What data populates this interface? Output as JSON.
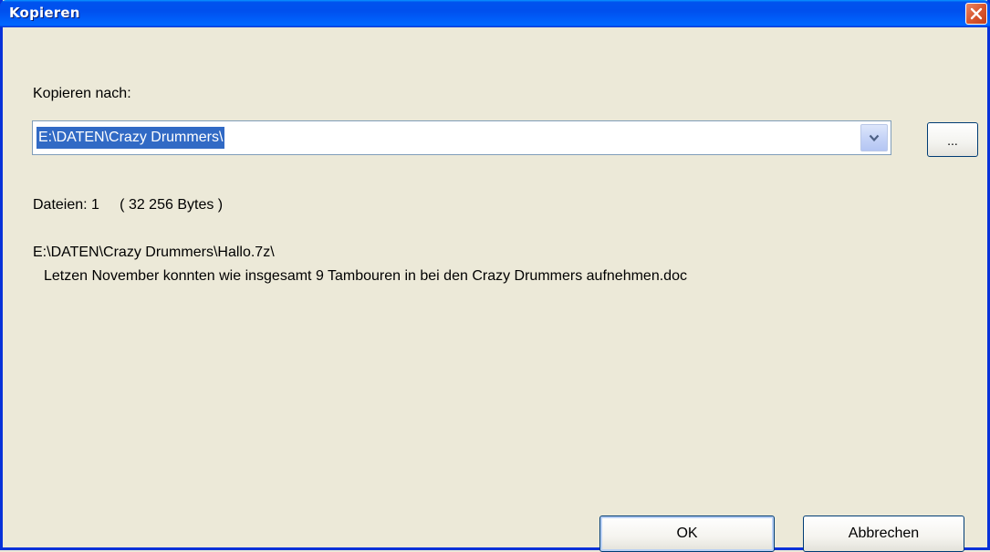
{
  "window": {
    "title": "Kopieren",
    "close_icon": "close-x-icon"
  },
  "form": {
    "copy_to_label": "Kopieren nach:",
    "destination_value": "E:\\DATEN\\Crazy Drummers\\",
    "dropdown_icon": "chevron-down-icon",
    "browse_label": "..."
  },
  "summary": {
    "files_text": "Dateien: 1     ( 32 256 Bytes )"
  },
  "source": {
    "path": "E:\\DATEN\\Crazy Drummers\\Hallo.7z\\",
    "file": "Letzen November konnten wie insgesamt 9 Tambouren in bei den Crazy Drummers aufnehmen.doc"
  },
  "buttons": {
    "ok_label": "OK",
    "cancel_label": "Abbrechen"
  },
  "colors": {
    "titlebar": "#0054e3",
    "dialog_background": "#ece9d8",
    "selection": "#316ac5",
    "close_button": "#d95830"
  }
}
